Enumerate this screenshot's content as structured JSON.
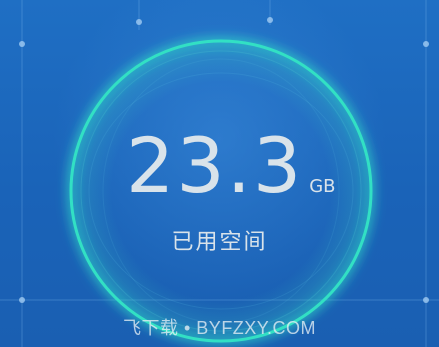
{
  "storage": {
    "used_value": "23.3",
    "used_unit": "GB",
    "used_label": "已用空间"
  },
  "watermark": {
    "text": "飞下载 • BYFZXY.COM"
  },
  "colors": {
    "background": "#1a63b8",
    "ring": "#32e0c4",
    "text": "#d9e3ea"
  }
}
